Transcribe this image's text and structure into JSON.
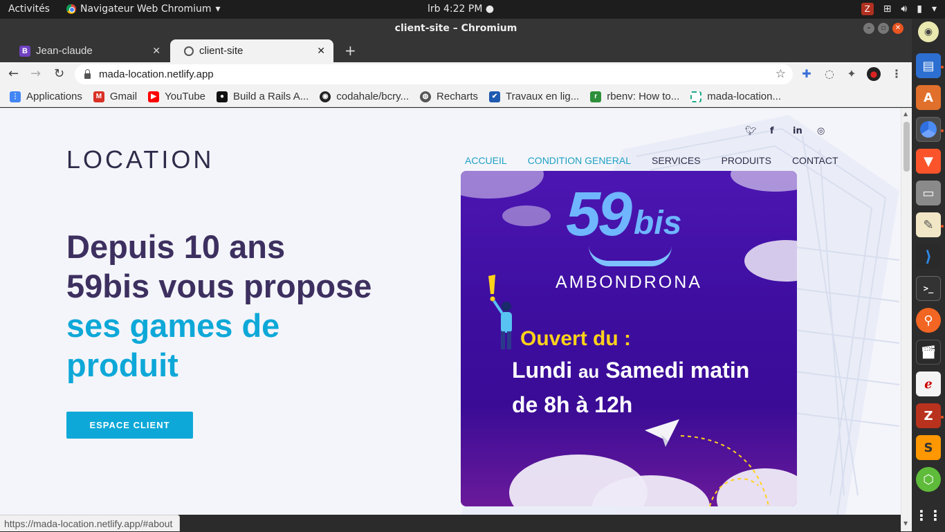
{
  "system": {
    "activities": "Activités",
    "app_name": "Navigateur Web Chromium",
    "clock": "lrb   4:22 PM ●"
  },
  "window": {
    "title": "client-site – Chromium"
  },
  "tabs": [
    {
      "label": "Jean-claude",
      "favicon": "B"
    },
    {
      "label": "client-site",
      "favicon": "globe"
    }
  ],
  "omnibox": {
    "url": "mada-location.netlify.app"
  },
  "bookmarks": [
    {
      "label": "Applications",
      "icon": "apps-grid-icon",
      "color": "#4285f4"
    },
    {
      "label": "Gmail",
      "icon": "gmail-icon",
      "color": "#d93025"
    },
    {
      "label": "YouTube",
      "icon": "youtube-icon",
      "color": "#ff0000"
    },
    {
      "label": "Build a Rails A...",
      "icon": "dev-icon",
      "color": "#111111"
    },
    {
      "label": "codahale/bcry...",
      "icon": "github-icon",
      "color": "#222222"
    },
    {
      "label": "Recharts",
      "icon": "globe-icon",
      "color": "#555555"
    },
    {
      "label": "Travaux en lig...",
      "icon": "flag-icon",
      "color": "#1d5ab0"
    },
    {
      "label": "rbenv: How to...",
      "icon": "rbenv-icon",
      "color": "#2d8f3a"
    },
    {
      "label": "mada-location...",
      "icon": "dotted-icon",
      "color": "#1aa88a"
    }
  ],
  "page": {
    "logo": "LOCATION",
    "nav": [
      {
        "label": "ACCUEIL"
      },
      {
        "label": "CONDITION GENERAL"
      },
      {
        "label": "SERVICES"
      },
      {
        "label": "PRODUITS"
      },
      {
        "label": "CONTACT"
      }
    ],
    "social": [
      "twitter-icon",
      "facebook-icon",
      "linkedin-icon",
      "instagram-icon"
    ],
    "hero": {
      "line1": "Depuis 10 ans",
      "line2": "59bis vous propose",
      "line3": "ses games de",
      "line4": "produit"
    },
    "cta": "ESPACE CLIENT",
    "poster": {
      "brand_number": "59",
      "brand_suffix": "bis",
      "city": "AMBONDRONA",
      "open_label": "Ouvert du :",
      "days_a": "Lundi",
      "days_mid": "au",
      "days_b": "Samedi matin",
      "hours_a": "de 8h",
      "hours_mid": "à",
      "hours_b": "12h"
    },
    "colors": {
      "accent": "#0ea8d8",
      "heading": "#3d3060",
      "poster": "#4c16b2"
    }
  },
  "status": {
    "url": "https://mada-location.netlify.app/#about"
  }
}
